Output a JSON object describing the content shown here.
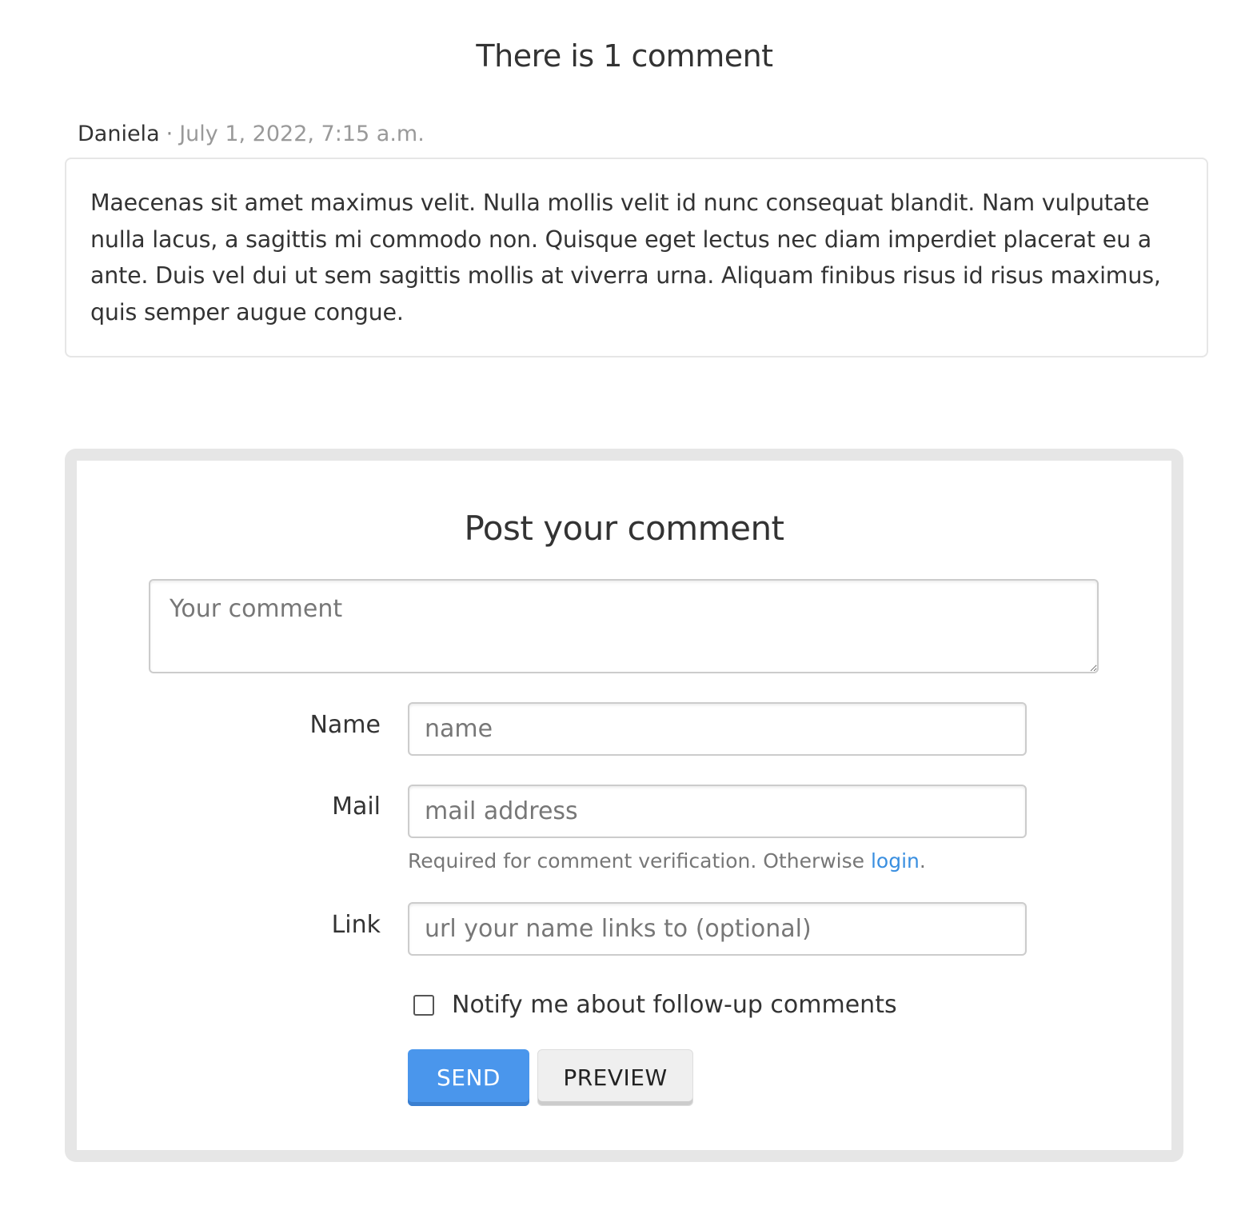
{
  "comments": {
    "count_heading": "There is 1 comment",
    "items": [
      {
        "author": "Daniela",
        "separator": "·",
        "date": "July 1, 2022, 7:15 a.m.",
        "body": "Maecenas sit amet maximus velit. Nulla mollis velit id nunc consequat blandit. Nam vulputate nulla lacus, a sagittis mi commodo non. Quisque eget lectus nec diam imperdiet placerat eu a ante. Duis vel dui ut sem sagittis mollis at viverra urna. Aliquam finibus risus id risus maximus, quis semper augue congue."
      }
    ]
  },
  "form": {
    "title": "Post your comment",
    "comment_placeholder": "Your comment",
    "name_label": "Name",
    "name_placeholder": "name",
    "mail_label": "Mail",
    "mail_placeholder": "mail address",
    "mail_help": "Required for comment verification. Otherwise ",
    "mail_help_link": "login",
    "mail_help_end": ".",
    "link_label": "Link",
    "link_placeholder": "url your name links to (optional)",
    "notify_label": "Notify me about follow-up comments",
    "notify_checked": false,
    "send_label": "SEND",
    "preview_label": "PREVIEW"
  },
  "colors": {
    "accent": "#4a96ec",
    "link": "#3a8fe0",
    "panel_border": "#e6e6e6"
  }
}
